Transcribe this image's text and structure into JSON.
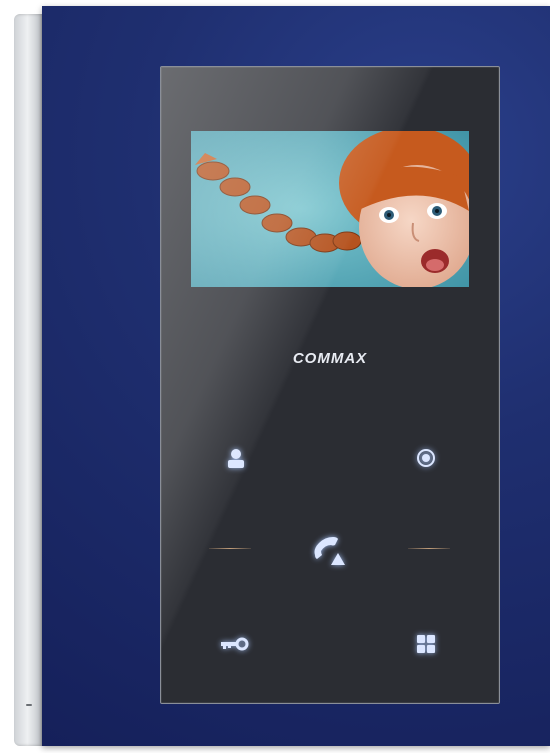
{
  "device": {
    "brand_label": "COMMAX",
    "colors": {
      "front_panel": "#1f2f70",
      "glass_panel": "#2b2d33",
      "icon_glow": "#cfe0ff",
      "separator": "#c8a07a"
    },
    "screen": {
      "content": "photo-girl-with-braids-surprised",
      "background": "#5fb4c2"
    },
    "buttons": [
      {
        "id": "monitor",
        "icon": "person-icon"
      },
      {
        "id": "record",
        "icon": "record-dot-icon"
      },
      {
        "id": "talk",
        "icon": "handset-icon"
      },
      {
        "id": "door-open",
        "icon": "key-icon"
      },
      {
        "id": "menu",
        "icon": "grid-menu-icon"
      }
    ]
  }
}
